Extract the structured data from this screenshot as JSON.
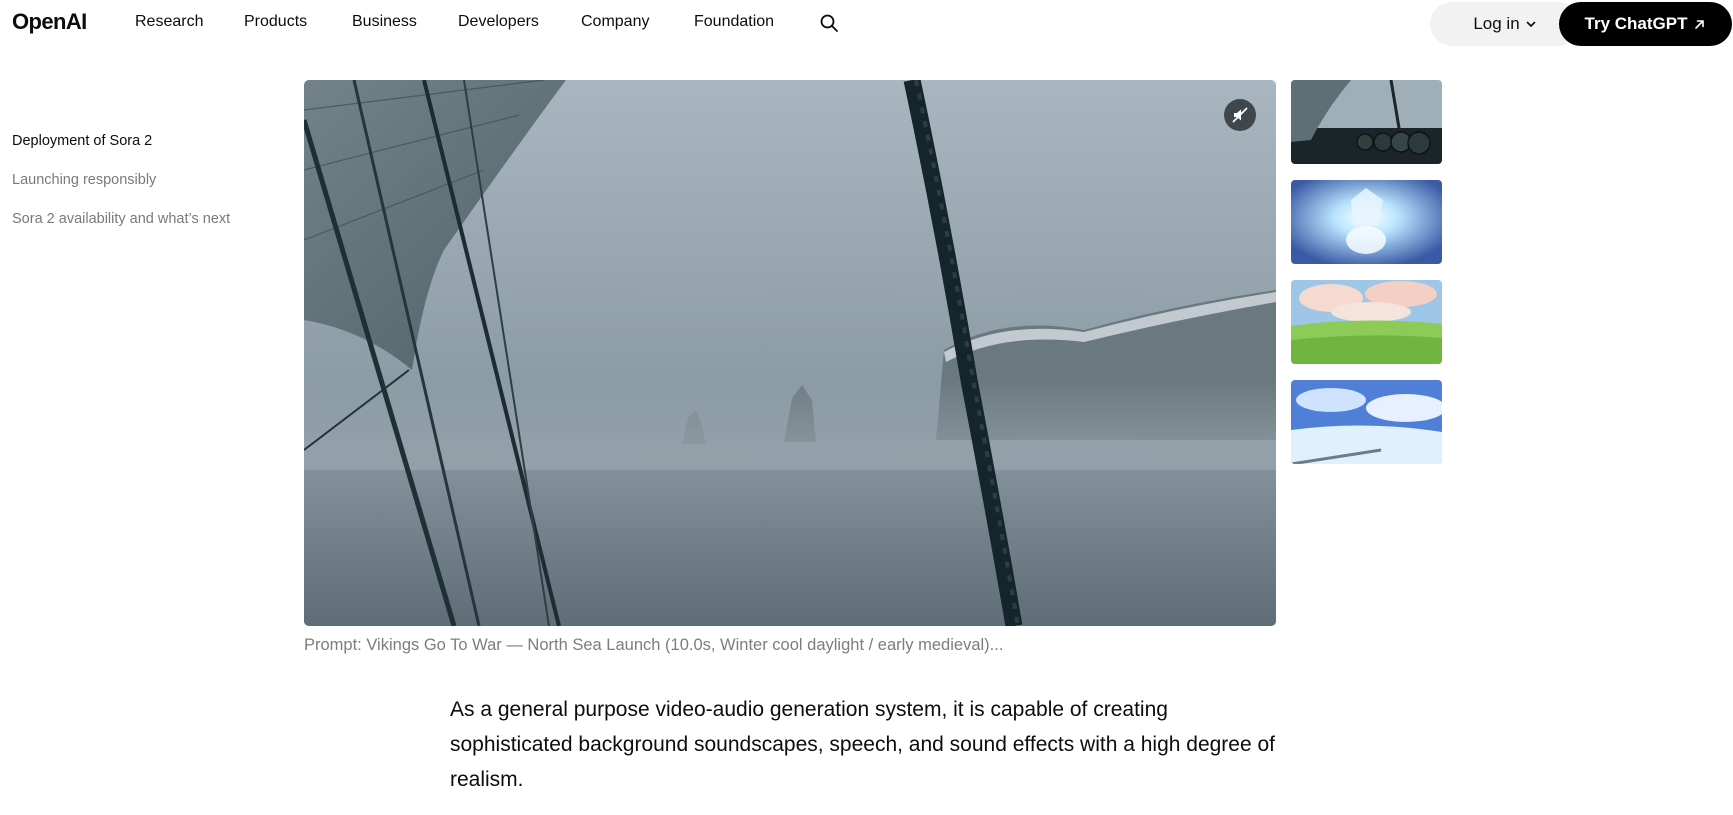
{
  "header": {
    "logo": "OpenAI",
    "nav": [
      "Research",
      "Products",
      "Business",
      "Developers",
      "Company",
      "Foundation"
    ],
    "search_icon": "search-icon",
    "login_label": "Log in",
    "cta_label": "Try ChatGPT"
  },
  "toc": {
    "items": [
      "Deployment of Sora 2",
      "Launching responsibly",
      "Sora 2 availability and what’s next"
    ],
    "active_index": 0
  },
  "video": {
    "mute_icon": "muted-speaker-icon",
    "caption": "Prompt: Vikings Go To War — North Sea Launch (10.0s, Winter cool daylight / early medieval)..."
  },
  "thumbnails": [
    "viking-ship-thumbnail",
    "glowing-anime-figure-thumbnail",
    "grassy-field-sky-thumbnail",
    "bright-sky-clouds-thumbnail"
  ],
  "body": {
    "paragraph": "As a general purpose video-audio generation system, it is capable of creating sophisticated background soundscapes, speech, and sound effects with a high degree of realism."
  },
  "colors": {
    "accent": "#000000",
    "login_bg": "#f2f2f2",
    "muted_text": "#7a7a7a"
  }
}
